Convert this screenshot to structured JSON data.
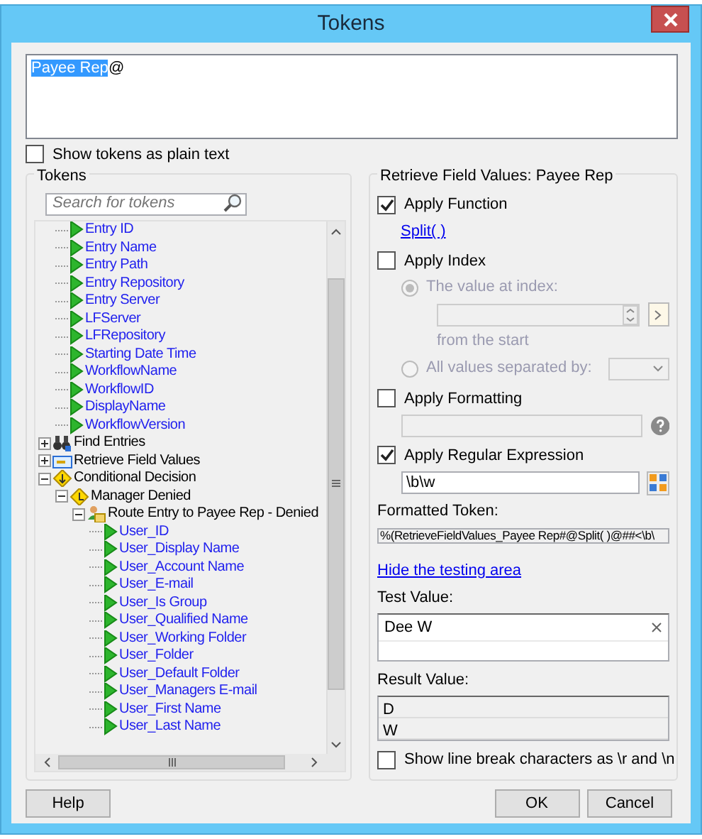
{
  "window": {
    "title": "Tokens"
  },
  "token_editor": {
    "selected_token": "Payee Rep",
    "text_after": "@"
  },
  "show_plain_text": {
    "label": "Show tokens as plain text",
    "checked": false
  },
  "tokens_panel": {
    "title": "Tokens",
    "search": {
      "placeholder": "Search for tokens"
    },
    "tree": [
      {
        "children": [
          {
            "label": "Entry ID",
            "kind": "token"
          },
          {
            "label": "Entry Name",
            "kind": "token"
          },
          {
            "label": "Entry Path",
            "kind": "token"
          },
          {
            "label": "Entry Repository",
            "kind": "token"
          },
          {
            "label": "Entry Server",
            "kind": "token"
          },
          {
            "label": "LFServer",
            "kind": "token"
          },
          {
            "label": "LFRepository",
            "kind": "token"
          },
          {
            "label": "Starting Date Time",
            "kind": "token"
          },
          {
            "label": "WorkflowName",
            "kind": "token"
          },
          {
            "label": "WorkflowID",
            "kind": "token"
          },
          {
            "label": "DisplayName",
            "kind": "token"
          },
          {
            "label": "WorkflowVersion",
            "kind": "token"
          }
        ]
      },
      {
        "label": "Find Entries",
        "kind": "search-activity",
        "expanded": false
      },
      {
        "label": "Retrieve Field Values",
        "kind": "fields-activity",
        "expanded": false
      },
      {
        "label": "Conditional Decision",
        "kind": "decision",
        "expanded": true,
        "children": [
          {
            "label": "Manager Denied",
            "kind": "branch",
            "expanded": true,
            "children": [
              {
                "label": "Route Entry to Payee Rep - Denied",
                "kind": "route",
                "expanded": true,
                "children": [
                  {
                    "label": "User_ID",
                    "kind": "token"
                  },
                  {
                    "label": "User_Display Name",
                    "kind": "token"
                  },
                  {
                    "label": "User_Account Name",
                    "kind": "token"
                  },
                  {
                    "label": "User_E-mail",
                    "kind": "token"
                  },
                  {
                    "label": "User_Is Group",
                    "kind": "token"
                  },
                  {
                    "label": "User_Qualified Name",
                    "kind": "token"
                  },
                  {
                    "label": "User_Working Folder",
                    "kind": "token"
                  },
                  {
                    "label": "User_Folder",
                    "kind": "token"
                  },
                  {
                    "label": "User_Default Folder",
                    "kind": "token"
                  },
                  {
                    "label": "User_Managers E-mail",
                    "kind": "token"
                  },
                  {
                    "label": "User_First Name",
                    "kind": "token"
                  },
                  {
                    "label": "User_Last Name",
                    "kind": "token"
                  }
                ]
              }
            ]
          }
        ]
      }
    ]
  },
  "options_panel": {
    "title": "Retrieve Field Values: Payee Rep",
    "apply_function": {
      "label": "Apply Function",
      "checked": true,
      "link": "Split( )"
    },
    "apply_index": {
      "label": "Apply Index",
      "checked": false,
      "value_at_index": {
        "label": "The value at index:",
        "selected": true,
        "from": "from the  start"
      },
      "all_values": {
        "label": "All values separated by:",
        "selected": false
      }
    },
    "apply_formatting": {
      "label": "Apply Formatting",
      "checked": false
    },
    "apply_regex": {
      "label": "Apply Regular Expression",
      "checked": true,
      "value": "\\b\\w"
    },
    "formatted_token": {
      "label": "Formatted Token:",
      "value": "%(RetrieveFieldValues_Payee Rep#@Split( )@##<\\b\\"
    },
    "toggle_link": "Hide the testing area",
    "test_value": {
      "label": "Test Value:",
      "value": "Dee W"
    },
    "result_value": {
      "label": "Result Value:",
      "lines": [
        "D",
        "W"
      ]
    },
    "show_line_breaks": {
      "label": "Show line break characters as \\r and \\n",
      "checked": false
    }
  },
  "buttons": {
    "help": "Help",
    "ok": "OK",
    "cancel": "Cancel"
  }
}
